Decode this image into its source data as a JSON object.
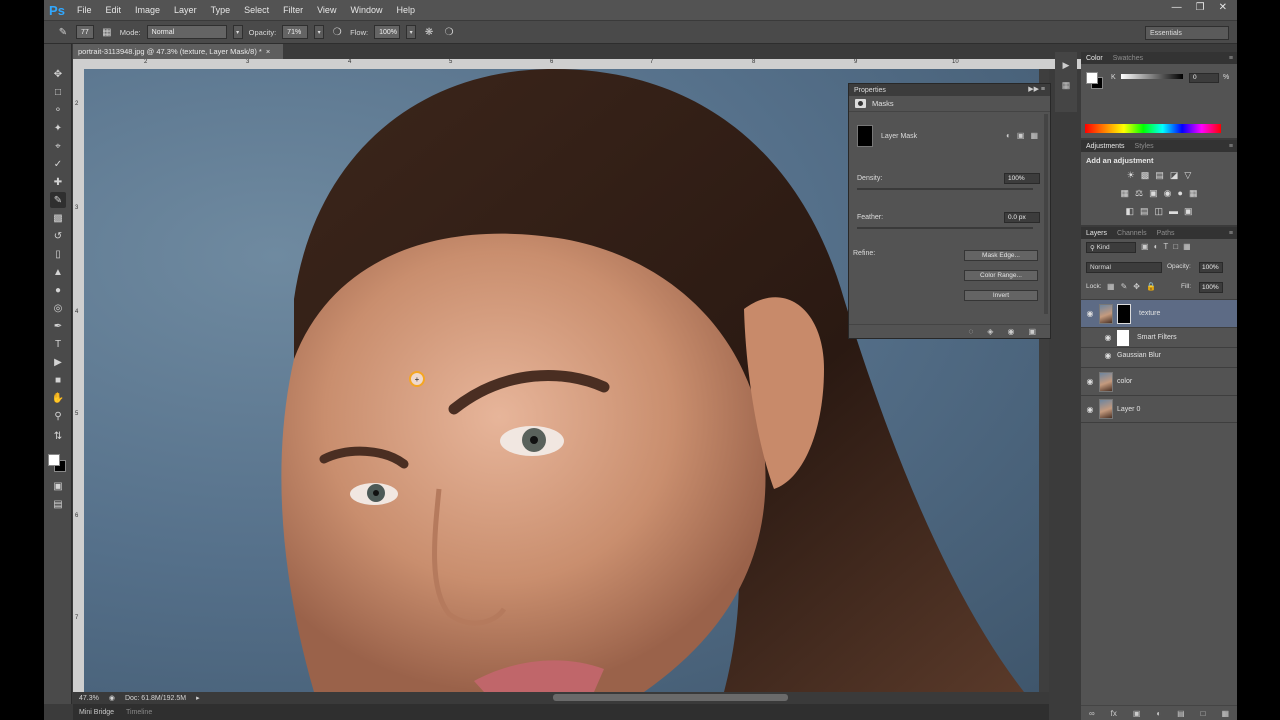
{
  "app": {
    "logo": "Ps"
  },
  "menu": [
    "File",
    "Edit",
    "Image",
    "Layer",
    "Type",
    "Select",
    "Filter",
    "View",
    "Window",
    "Help"
  ],
  "window_controls": [
    "minimize-icon",
    "restore-icon",
    "close-icon"
  ],
  "options": {
    "brush_size": "77",
    "mode_label": "Mode:",
    "mode_value": "Normal",
    "opacity_label": "Opacity:",
    "opacity_value": "71%",
    "flow_label": "Flow:",
    "flow_value": "100%",
    "workspace": "Essentials"
  },
  "document": {
    "tab_title": "portrait-3113948.jpg @ 47.3% (texture, Layer Mask/8) *",
    "zoom": "47.3%",
    "doc_size": "Doc: 61.8M/192.5M",
    "ruler_top": [
      "2",
      "3",
      "4",
      "5",
      "6",
      "7",
      "8",
      "9",
      "10"
    ],
    "ruler_left": [
      "2",
      "3",
      "4",
      "5",
      "6",
      "7"
    ]
  },
  "bottom_tabs": [
    "Mini Bridge",
    "Timeline"
  ],
  "properties": {
    "title": "Properties",
    "section": "Masks",
    "layer_mask": "Layer Mask",
    "density_label": "Density:",
    "density_value": "100%",
    "feather_label": "Feather:",
    "feather_value": "0.0 px",
    "refine_label": "Refine:",
    "buttons": [
      "Mask Edge...",
      "Color Range...",
      "Invert"
    ]
  },
  "color_panel": {
    "tabs": [
      "Color",
      "Swatches"
    ],
    "channel": "K",
    "value": "0",
    "unit": "%"
  },
  "adjustments": {
    "tabs": [
      "Adjustments",
      "Styles"
    ],
    "title": "Add an adjustment"
  },
  "layers": {
    "tabs": [
      "Layers",
      "Channels",
      "Paths"
    ],
    "kind": "Kind",
    "blend": "Normal",
    "opacity_label": "Opacity:",
    "opacity_value": "100%",
    "lock_label": "Lock:",
    "fill_label": "Fill:",
    "fill_value": "100%",
    "items": [
      {
        "name": "texture",
        "selected": true
      },
      {
        "name": "Smart Filters",
        "sub": true
      },
      {
        "name": "Gaussian Blur",
        "sub": true
      },
      {
        "name": "color"
      },
      {
        "name": "Layer 0"
      }
    ]
  },
  "colors": {
    "accent_selection": "#5d6b85",
    "cursor_ring": "#f5a623",
    "logo": "#31a8ff"
  }
}
